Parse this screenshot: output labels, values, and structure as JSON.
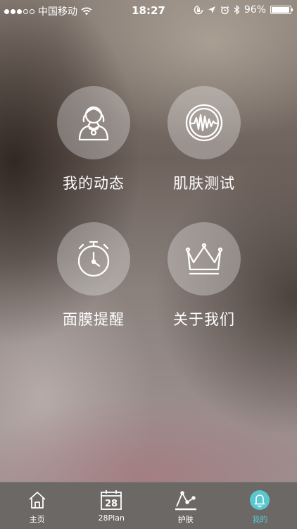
{
  "status_bar": {
    "carrier": "中国移动",
    "time": "18:27",
    "battery_percent": "96%",
    "battery_level": 0.96,
    "signal_strength": 3,
    "icons": [
      "wifi-icon",
      "rotation-lock-icon",
      "location-arrow-icon",
      "alarm-icon",
      "bluetooth-icon",
      "battery-icon"
    ]
  },
  "menu": {
    "items": [
      {
        "label": "我的动态",
        "icon": "user-profile-icon"
      },
      {
        "label": "肌肤测试",
        "icon": "waveform-icon"
      },
      {
        "label": "面膜提醒",
        "icon": "alarm-clock-icon"
      },
      {
        "label": "关于我们",
        "icon": "crown-icon"
      }
    ]
  },
  "tab_bar": {
    "active_tab": "我的",
    "accent_color": "#58c7cf",
    "calendar_day": "28",
    "tabs": [
      {
        "label": "主页",
        "icon": "home-icon"
      },
      {
        "label": "28Plan",
        "icon": "calendar-icon"
      },
      {
        "label": "护肤",
        "icon": "chart-line-icon"
      },
      {
        "label": "我的",
        "icon": "notification-bell-icon"
      }
    ]
  }
}
